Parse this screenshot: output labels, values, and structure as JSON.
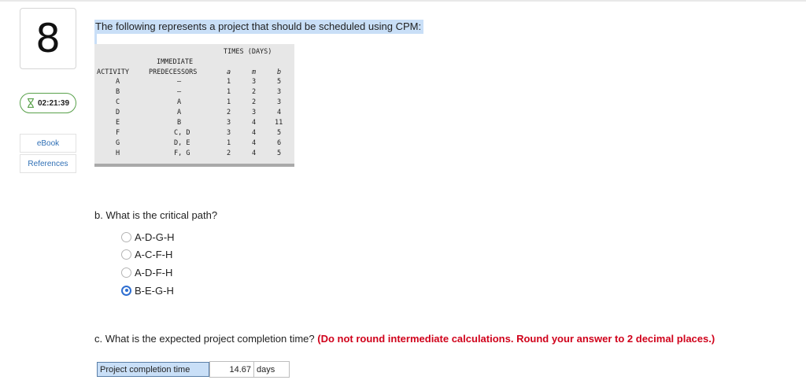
{
  "question": {
    "number": "8",
    "timer": "02:21:39",
    "links": {
      "ebook": "eBook",
      "references": "References"
    },
    "intro": "The following represents a project that should be scheduled using CPM:"
  },
  "table": {
    "times_header": "TIMES (DAYS)",
    "immediate_header": "IMMEDIATE",
    "activity_header": "ACTIVITY",
    "predecessors_header": "PREDECESSORS",
    "col_a": "a",
    "col_m": "m",
    "col_b": "b",
    "rows": [
      {
        "activity": "A",
        "pred": "—",
        "a": "1",
        "m": "3",
        "b": "5"
      },
      {
        "activity": "B",
        "pred": "—",
        "a": "1",
        "m": "2",
        "b": "3"
      },
      {
        "activity": "C",
        "pred": "A",
        "a": "1",
        "m": "2",
        "b": "3"
      },
      {
        "activity": "D",
        "pred": "A",
        "a": "2",
        "m": "3",
        "b": "4"
      },
      {
        "activity": "E",
        "pred": "B",
        "a": "3",
        "m": "4",
        "b": "11"
      },
      {
        "activity": "F",
        "pred": "C, D",
        "a": "3",
        "m": "4",
        "b": "5"
      },
      {
        "activity": "G",
        "pred": "D, E",
        "a": "1",
        "m": "4",
        "b": "6"
      },
      {
        "activity": "H",
        "pred": "F, G",
        "a": "2",
        "m": "4",
        "b": "5"
      }
    ]
  },
  "part_b": {
    "prompt": "b. What is the critical path?",
    "options": [
      {
        "label": "A-D-G-H",
        "selected": false
      },
      {
        "label": "A-C-F-H",
        "selected": false
      },
      {
        "label": "A-D-F-H",
        "selected": false
      },
      {
        "label": "B-E-G-H",
        "selected": true
      }
    ]
  },
  "part_c": {
    "prompt": "c. What is the expected project completion time?",
    "note": "(Do not round intermediate calculations. Round your answer to 2 decimal places.)",
    "answer_label": "Project completion time",
    "answer_value": "14.67",
    "answer_unit": "days"
  },
  "colors": {
    "accent_blue": "#2f6fd1",
    "link_blue": "#2f6fb5",
    "highlight": "#c9dff7",
    "warning_red": "#d0021b",
    "timer_green": "#59a14b"
  }
}
